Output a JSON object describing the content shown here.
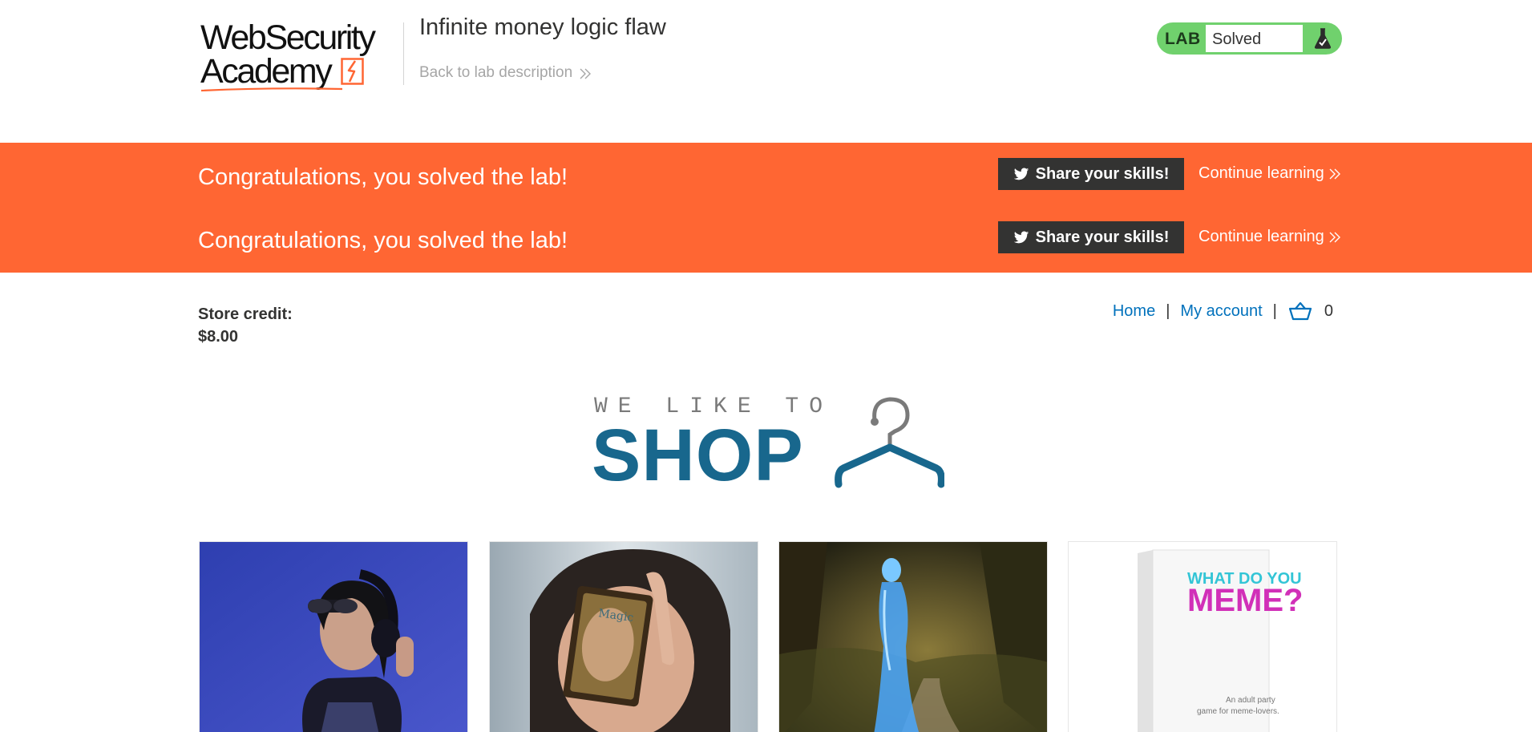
{
  "header": {
    "logo_line1": "WebSecurity",
    "logo_line2": "Academy",
    "lab_title": "Infinite money logic flaw",
    "back_link": "Back to lab description",
    "lab_badge": "LAB",
    "lab_status": "Solved"
  },
  "notification": {
    "rows": [
      {
        "message": "Congratulations, you solved the lab!",
        "share_label": "Share your skills!",
        "continue_label": "Continue learning"
      },
      {
        "message": "Congratulations, you solved the lab!",
        "share_label": "Share your skills!",
        "continue_label": "Continue learning"
      }
    ]
  },
  "account": {
    "store_credit_label": "Store credit:",
    "store_credit_value": "$8.00"
  },
  "nav": {
    "home": "Home",
    "separator": "|",
    "my_account": "My account",
    "cart_count": "0"
  },
  "banner": {
    "tagline": "WE LIKE TO",
    "headline": "SHOP"
  },
  "products": [
    {
      "icon": "headphones-photo"
    },
    {
      "icon": "magic-card-photo"
    },
    {
      "icon": "hologram-photo"
    },
    {
      "icon": "meme-box-photo",
      "box_title1": "WHAT DO YOU",
      "box_title2": "MEME?",
      "box_caption1": "An adult party",
      "box_caption2": "game for meme-lovers."
    }
  ],
  "colors": {
    "accent": "#ff6633",
    "link": "#0071bc",
    "shop_blue": "#18678d",
    "lab_green": "#70d16d",
    "dark_button": "#333332"
  }
}
